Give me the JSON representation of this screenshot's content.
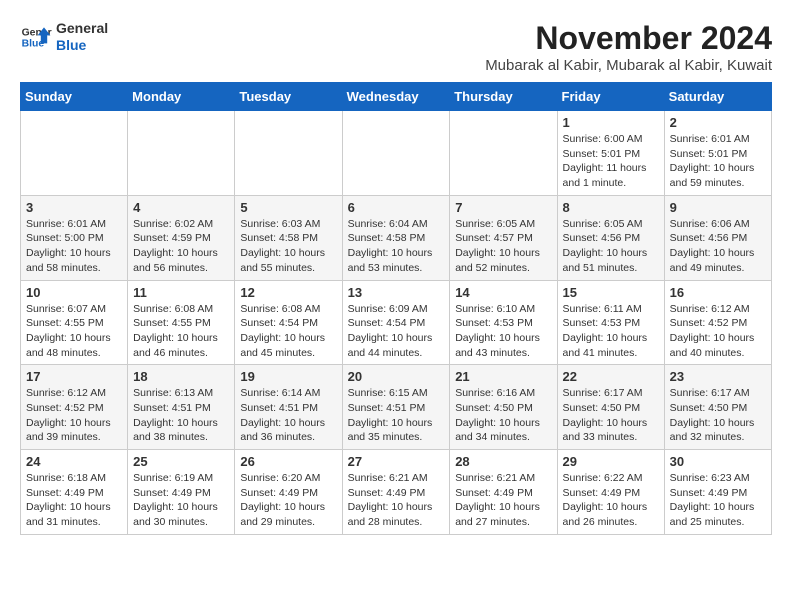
{
  "logo": {
    "general": "General",
    "blue": "Blue"
  },
  "title": "November 2024",
  "location": "Mubarak al Kabir, Mubarak al Kabir, Kuwait",
  "days_of_week": [
    "Sunday",
    "Monday",
    "Tuesday",
    "Wednesday",
    "Thursday",
    "Friday",
    "Saturday"
  ],
  "weeks": [
    [
      {
        "day": "",
        "info": ""
      },
      {
        "day": "",
        "info": ""
      },
      {
        "day": "",
        "info": ""
      },
      {
        "day": "",
        "info": ""
      },
      {
        "day": "",
        "info": ""
      },
      {
        "day": "1",
        "info": "Sunrise: 6:00 AM\nSunset: 5:01 PM\nDaylight: 11 hours and 1 minute."
      },
      {
        "day": "2",
        "info": "Sunrise: 6:01 AM\nSunset: 5:01 PM\nDaylight: 10 hours and 59 minutes."
      }
    ],
    [
      {
        "day": "3",
        "info": "Sunrise: 6:01 AM\nSunset: 5:00 PM\nDaylight: 10 hours and 58 minutes."
      },
      {
        "day": "4",
        "info": "Sunrise: 6:02 AM\nSunset: 4:59 PM\nDaylight: 10 hours and 56 minutes."
      },
      {
        "day": "5",
        "info": "Sunrise: 6:03 AM\nSunset: 4:58 PM\nDaylight: 10 hours and 55 minutes."
      },
      {
        "day": "6",
        "info": "Sunrise: 6:04 AM\nSunset: 4:58 PM\nDaylight: 10 hours and 53 minutes."
      },
      {
        "day": "7",
        "info": "Sunrise: 6:05 AM\nSunset: 4:57 PM\nDaylight: 10 hours and 52 minutes."
      },
      {
        "day": "8",
        "info": "Sunrise: 6:05 AM\nSunset: 4:56 PM\nDaylight: 10 hours and 51 minutes."
      },
      {
        "day": "9",
        "info": "Sunrise: 6:06 AM\nSunset: 4:56 PM\nDaylight: 10 hours and 49 minutes."
      }
    ],
    [
      {
        "day": "10",
        "info": "Sunrise: 6:07 AM\nSunset: 4:55 PM\nDaylight: 10 hours and 48 minutes."
      },
      {
        "day": "11",
        "info": "Sunrise: 6:08 AM\nSunset: 4:55 PM\nDaylight: 10 hours and 46 minutes."
      },
      {
        "day": "12",
        "info": "Sunrise: 6:08 AM\nSunset: 4:54 PM\nDaylight: 10 hours and 45 minutes."
      },
      {
        "day": "13",
        "info": "Sunrise: 6:09 AM\nSunset: 4:54 PM\nDaylight: 10 hours and 44 minutes."
      },
      {
        "day": "14",
        "info": "Sunrise: 6:10 AM\nSunset: 4:53 PM\nDaylight: 10 hours and 43 minutes."
      },
      {
        "day": "15",
        "info": "Sunrise: 6:11 AM\nSunset: 4:53 PM\nDaylight: 10 hours and 41 minutes."
      },
      {
        "day": "16",
        "info": "Sunrise: 6:12 AM\nSunset: 4:52 PM\nDaylight: 10 hours and 40 minutes."
      }
    ],
    [
      {
        "day": "17",
        "info": "Sunrise: 6:12 AM\nSunset: 4:52 PM\nDaylight: 10 hours and 39 minutes."
      },
      {
        "day": "18",
        "info": "Sunrise: 6:13 AM\nSunset: 4:51 PM\nDaylight: 10 hours and 38 minutes."
      },
      {
        "day": "19",
        "info": "Sunrise: 6:14 AM\nSunset: 4:51 PM\nDaylight: 10 hours and 36 minutes."
      },
      {
        "day": "20",
        "info": "Sunrise: 6:15 AM\nSunset: 4:51 PM\nDaylight: 10 hours and 35 minutes."
      },
      {
        "day": "21",
        "info": "Sunrise: 6:16 AM\nSunset: 4:50 PM\nDaylight: 10 hours and 34 minutes."
      },
      {
        "day": "22",
        "info": "Sunrise: 6:17 AM\nSunset: 4:50 PM\nDaylight: 10 hours and 33 minutes."
      },
      {
        "day": "23",
        "info": "Sunrise: 6:17 AM\nSunset: 4:50 PM\nDaylight: 10 hours and 32 minutes."
      }
    ],
    [
      {
        "day": "24",
        "info": "Sunrise: 6:18 AM\nSunset: 4:49 PM\nDaylight: 10 hours and 31 minutes."
      },
      {
        "day": "25",
        "info": "Sunrise: 6:19 AM\nSunset: 4:49 PM\nDaylight: 10 hours and 30 minutes."
      },
      {
        "day": "26",
        "info": "Sunrise: 6:20 AM\nSunset: 4:49 PM\nDaylight: 10 hours and 29 minutes."
      },
      {
        "day": "27",
        "info": "Sunrise: 6:21 AM\nSunset: 4:49 PM\nDaylight: 10 hours and 28 minutes."
      },
      {
        "day": "28",
        "info": "Sunrise: 6:21 AM\nSunset: 4:49 PM\nDaylight: 10 hours and 27 minutes."
      },
      {
        "day": "29",
        "info": "Sunrise: 6:22 AM\nSunset: 4:49 PM\nDaylight: 10 hours and 26 minutes."
      },
      {
        "day": "30",
        "info": "Sunrise: 6:23 AM\nSunset: 4:49 PM\nDaylight: 10 hours and 25 minutes."
      }
    ]
  ],
  "colors": {
    "header_bg": "#1565c0",
    "header_text": "#ffffff",
    "border": "#cccccc"
  }
}
